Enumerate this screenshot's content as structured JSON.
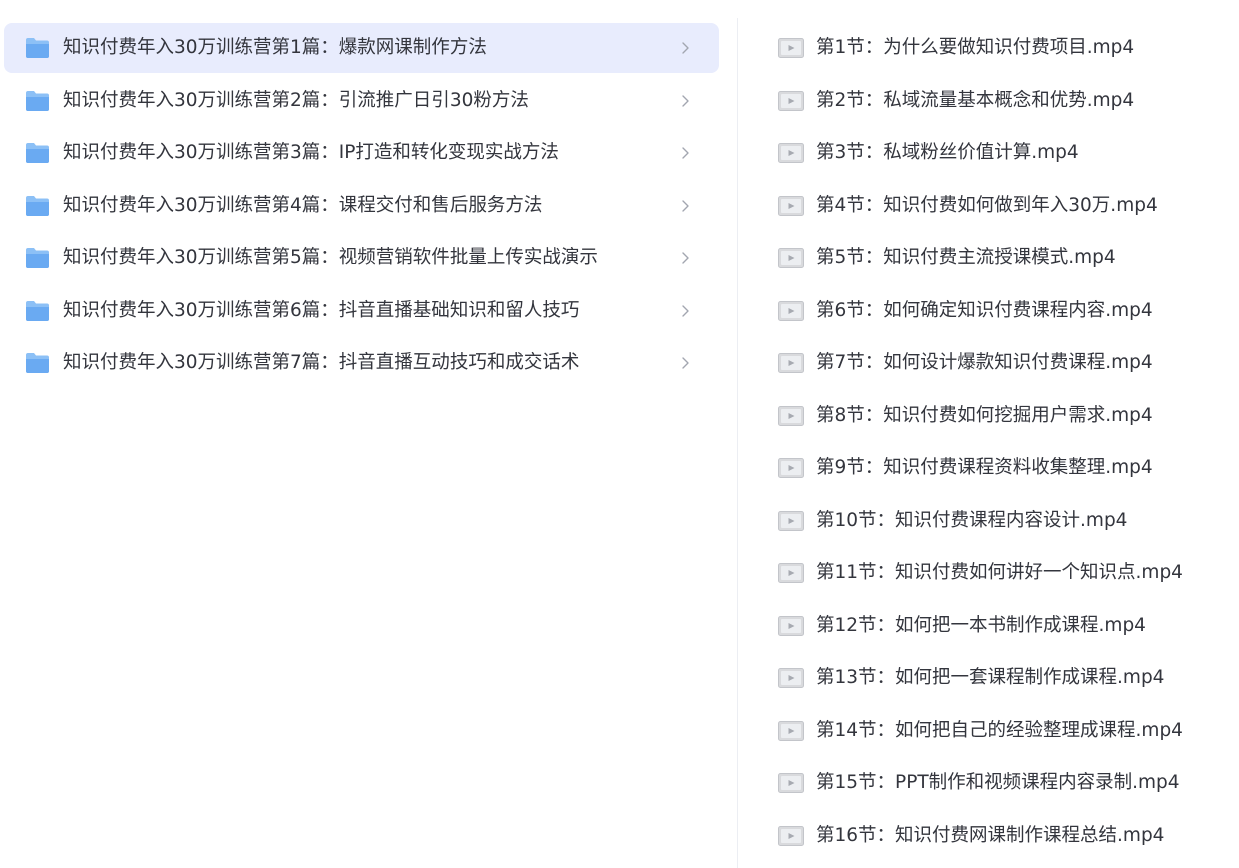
{
  "folders": [
    {
      "label": "知识付费年入30万训练营第1篇：爆款网课制作方法",
      "selected": true
    },
    {
      "label": "知识付费年入30万训练营第2篇：引流推广日引30粉方法",
      "selected": false
    },
    {
      "label": "知识付费年入30万训练营第3篇：IP打造和转化变现实战方法",
      "selected": false
    },
    {
      "label": "知识付费年入30万训练营第4篇：课程交付和售后服务方法",
      "selected": false
    },
    {
      "label": "知识付费年入30万训练营第5篇：视频营销软件批量上传实战演示",
      "selected": false
    },
    {
      "label": "知识付费年入30万训练营第6篇：抖音直播基础知识和留人技巧",
      "selected": false
    },
    {
      "label": "知识付费年入30万训练营第7篇：抖音直播互动技巧和成交话术",
      "selected": false
    }
  ],
  "files": [
    {
      "label": "第1节：为什么要做知识付费项目.mp4"
    },
    {
      "label": "第2节：私域流量基本概念和优势.mp4"
    },
    {
      "label": "第3节：私域粉丝价值计算.mp4"
    },
    {
      "label": "第4节：知识付费如何做到年入30万.mp4"
    },
    {
      "label": "第5节：知识付费主流授课模式.mp4"
    },
    {
      "label": "第6节：如何确定知识付费课程内容.mp4"
    },
    {
      "label": "第7节：如何设计爆款知识付费课程.mp4"
    },
    {
      "label": "第8节：知识付费如何挖掘用户需求.mp4"
    },
    {
      "label": "第9节：知识付费课程资料收集整理.mp4"
    },
    {
      "label": "第10节：知识付费课程内容设计.mp4"
    },
    {
      "label": "第11节：知识付费如何讲好一个知识点.mp4"
    },
    {
      "label": "第12节：如何把一本书制作成课程.mp4"
    },
    {
      "label": "第13节：如何把一套课程制作成课程.mp4"
    },
    {
      "label": "第14节：如何把自己的经验整理成课程.mp4"
    },
    {
      "label": "第15节：PPT制作和视频课程内容录制.mp4"
    },
    {
      "label": "第16节：知识付费网课制作课程总结.mp4"
    }
  ],
  "colors": {
    "selected_bg": "#e8ecfd",
    "folder_icon": "#6aaaf2",
    "text": "#33353d",
    "chevron": "#a2a6b0"
  },
  "icons": {
    "folder": "folder-icon",
    "chevron": "chevron-right-icon",
    "video": "video-thumbnail-icon"
  }
}
